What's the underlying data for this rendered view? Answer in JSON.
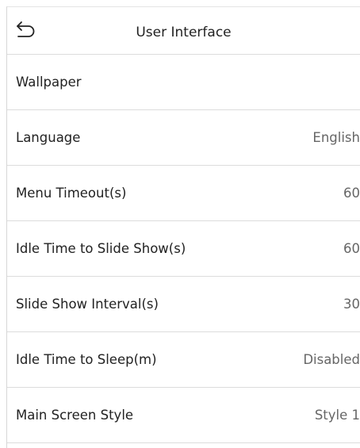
{
  "header": {
    "title": "User Interface",
    "back_icon": "back-arrow-icon"
  },
  "rows": [
    {
      "label": "Wallpaper",
      "value": ""
    },
    {
      "label": "Language",
      "value": "English"
    },
    {
      "label": "Menu Timeout(s)",
      "value": "60"
    },
    {
      "label": "Idle Time to Slide Show(s)",
      "value": "60"
    },
    {
      "label": "Slide Show Interval(s)",
      "value": "30"
    },
    {
      "label": "Idle Time to Sleep(m)",
      "value": "Disabled"
    },
    {
      "label": "Main Screen Style",
      "value": "Style 1"
    }
  ],
  "colors": {
    "text": "#222222",
    "value_text": "#666666",
    "divider": "#dcdcdc",
    "background": "#ffffff"
  }
}
